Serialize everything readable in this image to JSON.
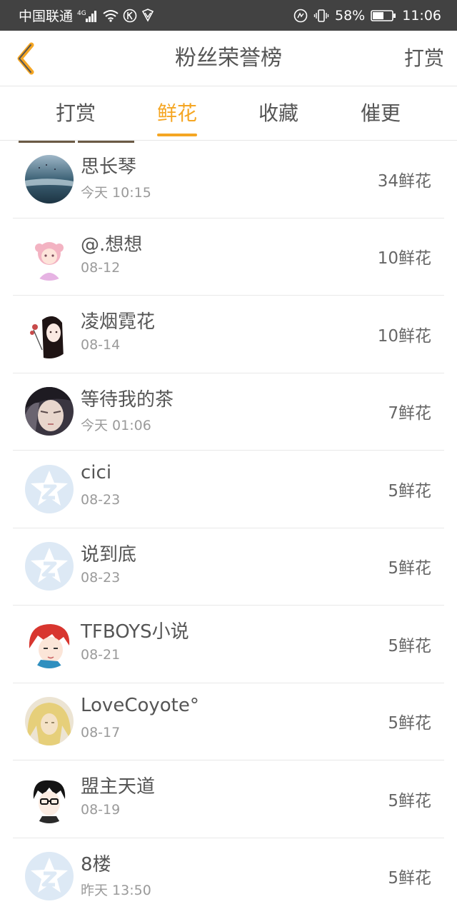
{
  "status_bar": {
    "carrier": "中国联通",
    "network": "4G",
    "battery": "58%",
    "time": "11:06"
  },
  "header": {
    "back_icon": "chevron-left-icon",
    "title": "粉丝荣誉榜",
    "action": "打赏",
    "accent_color": "#f5a623"
  },
  "tabs": [
    {
      "label": "打赏",
      "active": false
    },
    {
      "label": "鲜花",
      "active": true
    },
    {
      "label": "收藏",
      "active": false
    },
    {
      "label": "催更",
      "active": false
    }
  ],
  "fans": [
    {
      "name": "思长琴",
      "time": "今天 10:15",
      "count": "34鲜花"
    },
    {
      "name": "@.想想",
      "time": "08-12",
      "count": "10鲜花"
    },
    {
      "name": "凌烟霓花",
      "time": "08-14",
      "count": "10鲜花"
    },
    {
      "name": "等待我的茶",
      "time": "今天 01:06",
      "count": "7鲜花"
    },
    {
      "name": "cici",
      "time": "08-23",
      "count": "5鲜花"
    },
    {
      "name": "说到底",
      "time": "08-23",
      "count": "5鲜花"
    },
    {
      "name": "TFBOYS小说",
      "time": "08-21",
      "count": "5鲜花"
    },
    {
      "name": "LoveCoyote°",
      "time": "08-17",
      "count": "5鲜花"
    },
    {
      "name": "盟主天道",
      "time": "08-19",
      "count": "5鲜花"
    },
    {
      "name": "8楼",
      "time": "昨天 13:50",
      "count": "5鲜花"
    }
  ]
}
